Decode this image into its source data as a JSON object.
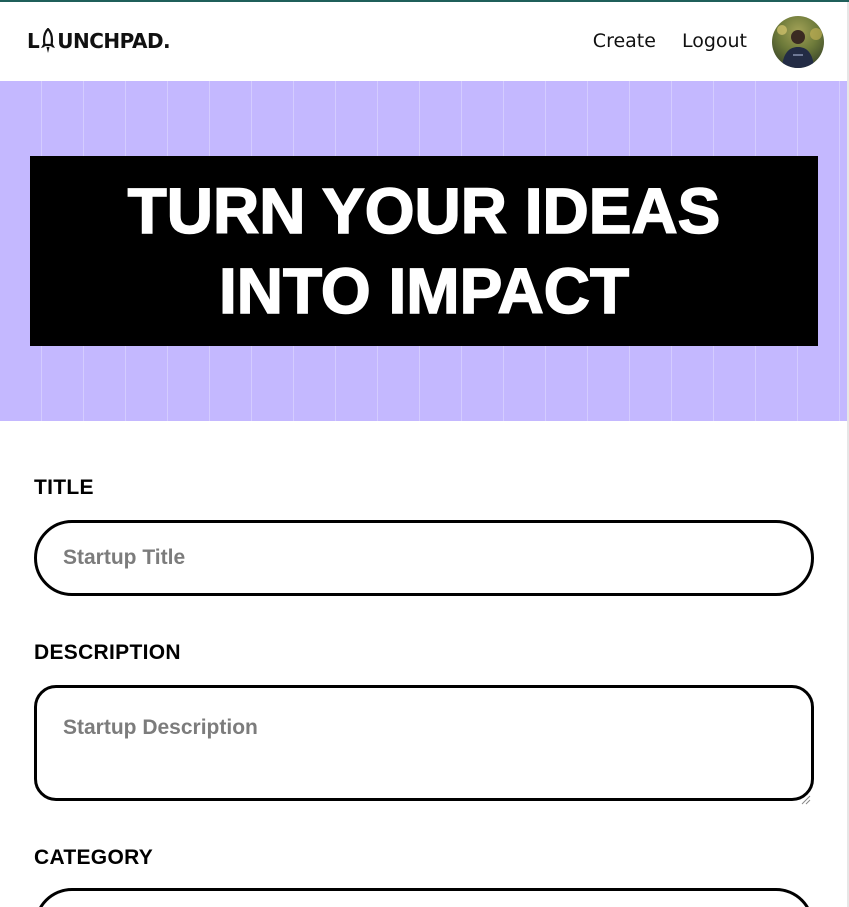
{
  "brand": {
    "logo_text_before": "L",
    "logo_text_after": "UNCHPAD."
  },
  "nav": {
    "create_label": "Create",
    "logout_label": "Logout"
  },
  "hero": {
    "line1": "TURN YOUR IDEAS",
    "line2": "INTO IMPACT",
    "background_color": "#c4b8ff"
  },
  "form": {
    "title": {
      "label": "TITLE",
      "placeholder": "Startup Title"
    },
    "description": {
      "label": "DESCRIPTION",
      "placeholder": "Startup Description"
    },
    "category": {
      "label": "CATEGORY"
    }
  },
  "icons": {
    "logo_rocket": "rocket-icon",
    "avatar": "user-avatar",
    "resize": "resize-handle-icon"
  }
}
